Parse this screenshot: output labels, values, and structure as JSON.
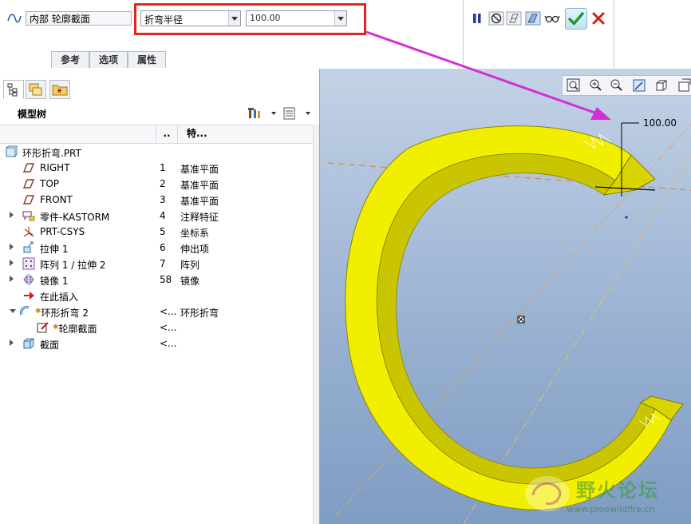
{
  "dashboard": {
    "section_field": "内部 轮廓截面",
    "bend_type": "折弯半径",
    "bend_value": "100.00",
    "tabs": [
      "参考",
      "选项",
      "属性"
    ],
    "buttons": [
      "pause-icon",
      "stop-icon",
      "geometry-check-icon",
      "preview-icon",
      "glasses-icon",
      "ok-check-icon",
      "cancel-x-icon"
    ],
    "accent": "#e0261f",
    "arrow_color": "#d42fd4"
  },
  "model_tree": {
    "title": "模型树",
    "columns": [
      "..",
      "特..."
    ],
    "rows": [
      {
        "label": "环形折弯.PRT",
        "num": "",
        "type": "",
        "icon": "part-icon"
      },
      {
        "label": "RIGHT",
        "num": "1",
        "type": "基准平面",
        "icon": "datum-plane-icon"
      },
      {
        "label": "TOP",
        "num": "2",
        "type": "基准平面",
        "icon": "datum-plane-icon"
      },
      {
        "label": "FRONT",
        "num": "3",
        "type": "基准平面",
        "icon": "datum-plane-icon"
      },
      {
        "label": "零件-KASTORM",
        "num": "4",
        "type": "注释特征",
        "icon": "annotation-icon"
      },
      {
        "label": "PRT-CSYS",
        "num": "5",
        "type": "坐标系",
        "icon": "csys-icon"
      },
      {
        "label": "拉伸 1",
        "num": "6",
        "type": "伸出项",
        "icon": "extrude-icon"
      },
      {
        "label": "阵列 1 / 拉伸 2",
        "num": "7",
        "type": "阵列",
        "icon": "pattern-icon"
      },
      {
        "label": "镜像 1",
        "num": "58",
        "type": "镜像",
        "icon": "mirror-icon"
      },
      {
        "label": "在此插入",
        "num": "",
        "type": "",
        "icon": "insert-here-icon"
      },
      {
        "label": "环形折弯 2",
        "num": "<...",
        "type": "环形折弯",
        "icon": "toroidal-bend-icon"
      },
      {
        "label": "轮廓截面",
        "num": "<...",
        "type": "",
        "icon": "sketch-icon"
      },
      {
        "label": "截面",
        "num": "<...",
        "type": "",
        "icon": "section-icon"
      }
    ]
  },
  "viewport": {
    "dimension": "100.00",
    "watermark": "野火论坛",
    "watermark_url": "www.proewildfire.cn",
    "model_color": "#f2ee00"
  }
}
